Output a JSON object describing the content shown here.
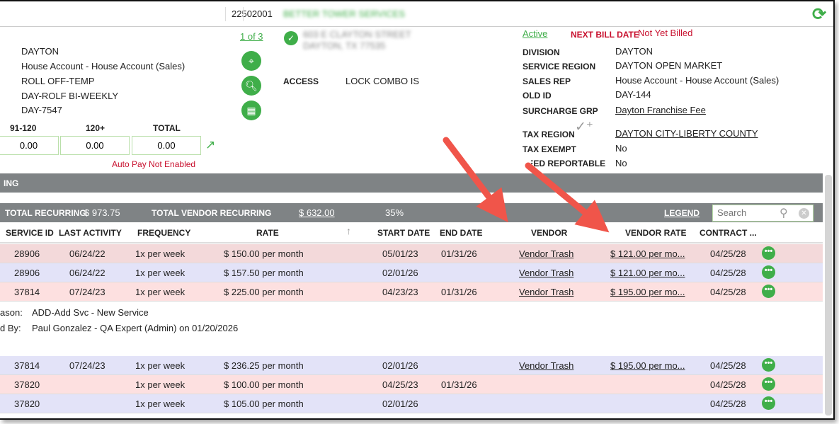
{
  "header": {
    "account_number": "22502001",
    "account_name": "BETTER TOWER SERVICES"
  },
  "left_info": [
    "DAYTON",
    "House Account - House Account (Sales)",
    "ROLL OFF-TEMP",
    "DAY-ROLF BI-WEEKLY",
    "DAY-7547"
  ],
  "aging": {
    "headers": [
      "91-120",
      "120+",
      "TOTAL"
    ],
    "values": [
      "0.00",
      "0.00",
      "0.00"
    ],
    "autopay": "Auto Pay Not Enabled"
  },
  "pager": "1 of 3",
  "address": [
    "603 E CLAYTON STREET",
    "DAYTON, TX 77535"
  ],
  "access": {
    "label": "ACCESS",
    "value": "LOCK COMBO IS"
  },
  "status": {
    "active": "Active",
    "next_bill_label": "NEXT BILL DATE",
    "next_bill_value": "Not Yet Billed"
  },
  "details": [
    {
      "label": "DIVISION",
      "value": "DAYTON"
    },
    {
      "label": "SERVICE REGION",
      "value": "DAYTON OPEN MARKET"
    },
    {
      "label": "SALES REP",
      "value": "House Account - House Account (Sales)"
    },
    {
      "label": "OLD ID",
      "value": "DAY-144"
    },
    {
      "label": "SURCHARGE GRP",
      "value": "Dayton Franchise Fee"
    },
    {
      "label": "TAX REGION",
      "value": "DAYTON CITY-LIBERTY COUNTY"
    },
    {
      "label": "TAX EXEMPT",
      "value": "No"
    },
    {
      "label": "FEED REPORTABLE",
      "value": "No"
    }
  ],
  "section_title": "ING",
  "totals": {
    "recurring_label": "TOTAL RECURRING",
    "recurring_value": "$ 973.75",
    "vendor_label": "TOTAL VENDOR RECURRING",
    "vendor_value": "$ 632.00",
    "percent": "35%",
    "legend": "LEGEND",
    "search_placeholder": "Search"
  },
  "columns": [
    "SERVICE ID",
    "LAST ACTIVITY",
    "FREQUENCY",
    "RATE",
    "START DATE",
    "END DATE",
    "VENDOR",
    "VENDOR RATE",
    "CONTRACT ..."
  ],
  "rows": [
    {
      "id": "28906",
      "last": "06/24/22",
      "freq": "1x per week",
      "rate": "$ 150.00 per month",
      "start": "05/01/23",
      "end": "01/31/26",
      "vendor": "Vendor Trash",
      "vrate": "$ 121.00 per mo...",
      "contract": "04/25/28",
      "dots": "•••"
    },
    {
      "id": "28906",
      "last": "06/24/22",
      "freq": "1x per week",
      "rate": "$ 157.50 per month",
      "start": "02/01/26",
      "end": "",
      "vendor": "Vendor Trash",
      "vrate": "$ 121.00 per mo...",
      "contract": "04/25/28",
      "dots": "•••"
    },
    {
      "id": "37814",
      "last": "07/24/23",
      "freq": "1x per week",
      "rate": "$ 225.00 per month",
      "start": "04/23/23",
      "end": "01/31/26",
      "vendor": "Vendor Trash",
      "vrate": "$ 195.00 per mo...",
      "contract": "04/25/28",
      "dots": "•••"
    },
    {
      "id": "37814",
      "last": "07/24/23",
      "freq": "1x per week",
      "rate": "$ 236.25 per month",
      "start": "02/01/26",
      "end": "",
      "vendor": "Vendor Trash",
      "vrate": "$ 195.00 per mo...",
      "contract": "04/25/28",
      "dots": "•••"
    },
    {
      "id": "37820",
      "last": "",
      "freq": "1x per week",
      "rate": "$ 100.00 per month",
      "start": "04/25/23",
      "end": "01/31/26",
      "vendor": "",
      "vrate": "",
      "contract": "04/25/28",
      "dots": "•••"
    },
    {
      "id": "37820",
      "last": "",
      "freq": "1x per week",
      "rate": "$ 105.00 per month",
      "start": "02/01/26",
      "end": "",
      "vendor": "",
      "vrate": "",
      "contract": "04/25/28",
      "dots": "•••"
    }
  ],
  "note": {
    "reason_label": "ason:",
    "reason_value": "ADD-Add Svc - New Service",
    "by_label": "d By:",
    "by_value": "Paul Gonzalez - QA Expert (Admin) on 01/20/2026"
  },
  "colors": {
    "green": "#3fae49",
    "red": "#c8102e",
    "pink_row": "#f3d9da",
    "pink_row_alt": "#fde0e0",
    "lavender_row": "#e3e3f8",
    "bar": "#7f8385",
    "arrow": "#f0554a"
  }
}
